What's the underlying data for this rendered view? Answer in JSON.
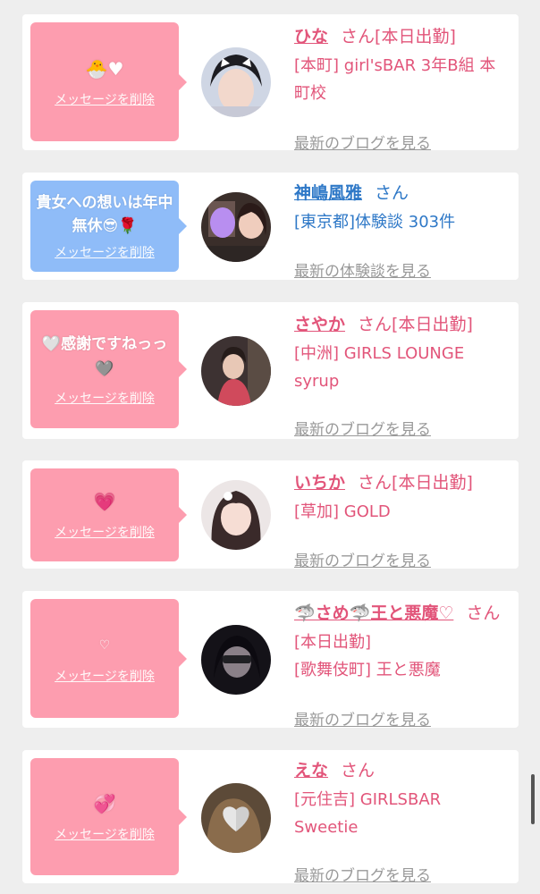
{
  "items": [
    {
      "message_emoji": "🐣♥",
      "message_text": "",
      "delete_label": "メッセージを削除",
      "name": "ひな",
      "honorific": "さん",
      "status": "[本日出勤]",
      "detail": "[本町] girl'sBAR 3年B組 本町校",
      "more_link": "最新のブログを見る",
      "bubble_color": "#fd9daf"
    },
    {
      "message_emoji": "",
      "message_text": "貴女への想いは年中無休😎🌹",
      "delete_label": "メッセージを削除",
      "name": "神嶋風雅",
      "honorific": "さん",
      "status": "",
      "detail": "[東京都]体験談 303件",
      "more_link": "最新の体験談を見る",
      "bubble_color": "#8fbcf8"
    },
    {
      "message_emoji": "",
      "message_text": "🤍感謝ですねっっ🩶",
      "delete_label": "メッセージを削除",
      "name": "さやか",
      "honorific": "さん",
      "status": "[本日出勤]",
      "detail": "[中洲] GIRLS LOUNGE syrup",
      "more_link": "最新のブログを見る",
      "bubble_color": "#fd9daf"
    },
    {
      "message_emoji": "💗",
      "message_text": "",
      "delete_label": "メッセージを削除",
      "name": "いちか",
      "honorific": "さん",
      "status": "[本日出勤]",
      "detail": "[草加] GOLD",
      "more_link": "最新のブログを見る",
      "bubble_color": "#fd9daf"
    },
    {
      "message_emoji": "♡",
      "message_text": "",
      "delete_label": "メッセージを削除",
      "name": "🦈さめ🦈王と悪魔♡",
      "honorific": "さん",
      "status": "[本日出勤]",
      "detail": "[歌舞伎町] 王と悪魔",
      "more_link": "最新のブログを見る",
      "bubble_color": "#fd9daf"
    },
    {
      "message_emoji": "💞",
      "message_text": "",
      "delete_label": "メッセージを削除",
      "name": "えな",
      "honorific": "さん",
      "status": "",
      "detail": "[元住吉] GIRLSBAR Sweetie",
      "more_link": "最新のブログを見る",
      "bubble_color": "#fd9daf"
    }
  ],
  "colors": {
    "accent_pink": "#e2557a",
    "accent_blue": "#2e78c7",
    "link_grey": "#999999",
    "background": "#eeeeee"
  }
}
